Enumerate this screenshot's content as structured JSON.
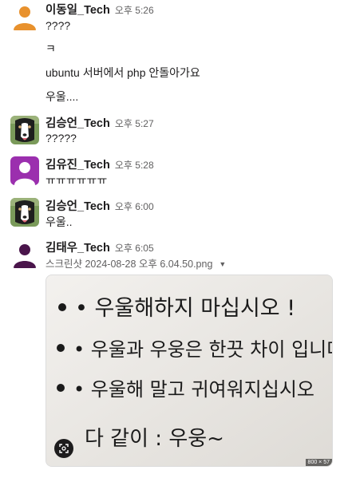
{
  "messages": [
    {
      "author": "이동일_Tech",
      "time": "오후 5:26",
      "avatar_icon": "default-user-avatar-orange",
      "avatar_color": "#e8912d",
      "lines": [
        "????",
        "ㅋ",
        "ubuntu 서버에서 php 안돌아가요",
        "우울...."
      ]
    },
    {
      "author": "김승언_Tech",
      "time": "오후 5:27",
      "avatar_icon": "dog-photo-avatar",
      "lines": [
        "?????"
      ]
    },
    {
      "author": "김유진_Tech",
      "time": "오후 5:28",
      "avatar_icon": "default-user-avatar-purple",
      "avatar_color": "#9b2fae",
      "lines": [
        "ㅠㅠㅠㅠㅠㅠ"
      ]
    },
    {
      "author": "김승언_Tech",
      "time": "오후 6:00",
      "avatar_icon": "dog-photo-avatar",
      "lines": [
        "우울.."
      ]
    },
    {
      "author": "김태우_Tech",
      "time": "오후 6:05",
      "avatar_icon": "default-user-avatar-dark-purple",
      "avatar_color": "#4a154b",
      "file_name": "스크린샷 2024-08-28 오후 6.04.50.png",
      "attachment": {
        "image_lines": [
          "• 우울해하지 마십시오 !",
          "• 우울과 우웅은 한끗 차이 입니다!",
          "• 우울해 말고 귀여워지십시오",
          "다 같이 : 우웅~"
        ],
        "dimensions": "800 × 57",
        "lens_icon": "image-search-icon"
      }
    }
  ]
}
